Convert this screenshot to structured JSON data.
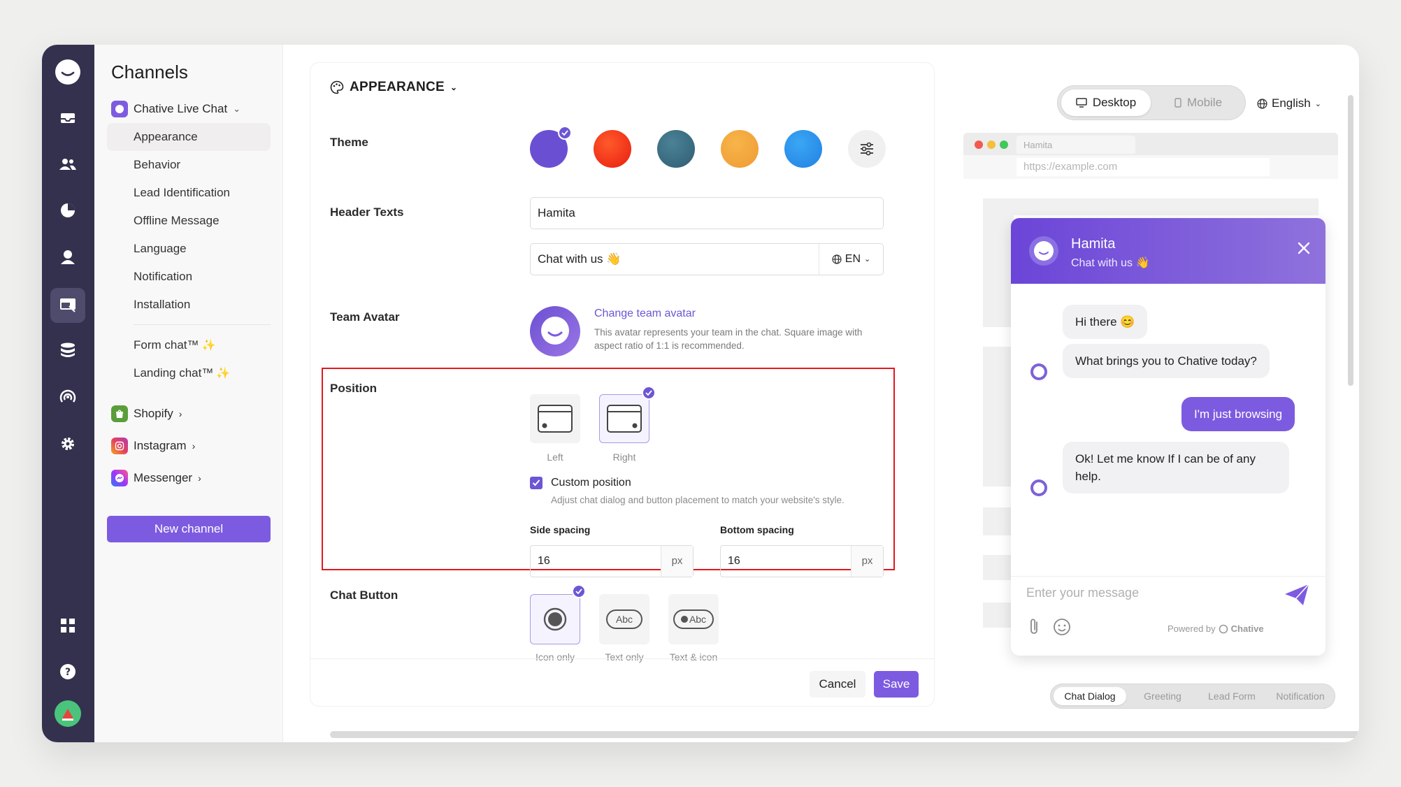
{
  "sidebar": {
    "title": "Channels",
    "channel": {
      "name": "Chative Live Chat",
      "chevron": "⌄"
    },
    "items": [
      {
        "label": "Appearance"
      },
      {
        "label": "Behavior"
      },
      {
        "label": "Lead Identification"
      },
      {
        "label": "Offline Message"
      },
      {
        "label": "Language"
      },
      {
        "label": "Notification"
      },
      {
        "label": "Installation"
      }
    ],
    "extras": [
      {
        "label": "Form chat™"
      },
      {
        "label": "Landing chat™"
      }
    ],
    "other_channels": [
      {
        "name": "Shopify",
        "color": "#5a9e3a"
      },
      {
        "name": "Instagram",
        "color": "#e4405f"
      },
      {
        "name": "Messenger",
        "color": "#8a4df0"
      }
    ],
    "new_channel": "New channel"
  },
  "appearance": {
    "title": "APPEARANCE",
    "theme_label": "Theme",
    "themes": [
      "#6b4fd3",
      "#ee3216",
      "#3f7187",
      "#f3a33c",
      "#2c92ec"
    ],
    "header_label": "Header Texts",
    "header_title": "Hamita",
    "header_subtitle": "Chat with us 👋",
    "header_lang": "EN",
    "avatar_label": "Team Avatar",
    "avatar_link": "Change team avatar",
    "avatar_hint": "This avatar represents your team in the chat. Square image with aspect ratio of 1:1 is recommended.",
    "position_label": "Position",
    "position_left": "Left",
    "position_right": "Right",
    "custom_position": "Custom position",
    "custom_position_hint": "Adjust chat dialog and button placement to match your website's style.",
    "side_spacing_label": "Side spacing",
    "side_spacing": "16",
    "bottom_spacing_label": "Bottom spacing",
    "bottom_spacing": "16",
    "unit": "px",
    "chat_button_label": "Chat Button",
    "chat_button_opts": [
      "Icon only",
      "Text only",
      "Text & icon"
    ],
    "abc": "Abc",
    "cancel": "Cancel",
    "save": "Save"
  },
  "preview": {
    "device_desktop": "Desktop",
    "device_mobile": "Mobile",
    "language": "English",
    "browser_tab": "Hamita",
    "url": "https://example.com",
    "widget_name": "Hamita",
    "widget_sub": "Chat with us 👋",
    "msg1": "Hi there 😊",
    "msg2": "What brings you to Chative today?",
    "msg3": "I'm just browsing",
    "msg4": "Ok! Let me know If I can be of any help.",
    "input_placeholder": "Enter your message",
    "powered_by": "Powered by",
    "brand": "Chative",
    "tabs": [
      "Chat Dialog",
      "Greeting",
      "Lead Form",
      "Notification"
    ]
  },
  "colors": {
    "accent": "#7d5be0",
    "rail": "#34314f",
    "highlight": "#e0191e"
  }
}
